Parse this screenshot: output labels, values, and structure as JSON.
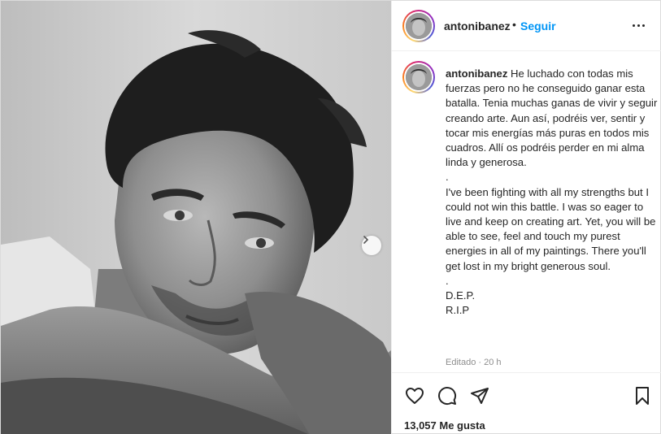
{
  "post": {
    "author": "antonibanez",
    "separator": "•",
    "follow_label": "Seguir",
    "more_icon": "more-options-icon",
    "next_icon": "chevron-right-icon",
    "caption": {
      "username": "antonibanez",
      "text": " He luchado con todas mis fuerzas pero no he conseguido ganar esta batalla. Tenia muchas ganas de vivir y seguir creando arte. Aun así, podréis ver, sentir y tocar mis energías más puras en todos mis cuadros. Allí os podréis perder en mi alma linda y generosa.\n.\nI've been fighting with all my strengths but I could not win this battle. I was so eager to live and keep on creating art. Yet, you will be able to see, feel and touch my purest energies in all of my paintings. There you'll get lost in my bright generous soul.\n.\nD.E.P.\nR.I.P"
    },
    "edited_label": "Editado · 20 h",
    "actions": {
      "like_icon": "heart-icon",
      "comment_icon": "comment-icon",
      "share_icon": "send-icon",
      "save_icon": "bookmark-icon"
    },
    "likes_label": "13,057 Me gusta"
  },
  "colors": {
    "accent": "#0095f6",
    "text": "#262626",
    "muted": "#8e8e8e"
  }
}
